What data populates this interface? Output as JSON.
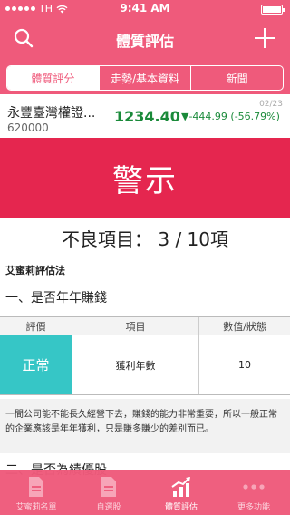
{
  "status_bar": {
    "carrier": "TH",
    "time": "9:41 AM"
  },
  "navbar": {
    "title": "體質評估"
  },
  "tabs": [
    {
      "label": "體質評分",
      "active": true
    },
    {
      "label": "走勢/基本資料",
      "active": false
    },
    {
      "label": "新聞",
      "active": false
    }
  ],
  "stock": {
    "name": "永豐臺灣權證...",
    "code": "620000",
    "price": "1234.40",
    "change": "▼-444.99 (-56.79%)",
    "date": "02/23"
  },
  "warning": {
    "label": "警示"
  },
  "summary": {
    "bad_items": "不良項目： 3 / 10項"
  },
  "method": {
    "title": "艾蜜莉評估法"
  },
  "section1": {
    "title": "一、是否年年賺錢"
  },
  "table": {
    "headers": [
      "評價",
      "項目",
      "數值/狀態"
    ],
    "rows": [
      {
        "rating": "正常",
        "item": "獲利年數",
        "value": "10"
      }
    ]
  },
  "note": {
    "text": "一間公司能不能長久經營下去，賺錢的能力非常重要，所以一般正常的企業應該是年年獲利，只是賺多賺少的差別而已。"
  },
  "section2": {
    "title": "二、是否為績優股"
  },
  "tabbar": [
    {
      "label": "艾蜜莉名單",
      "icon": "document-icon",
      "active": false
    },
    {
      "label": "自選股",
      "icon": "document-icon",
      "active": false
    },
    {
      "label": "體質評估",
      "icon": "chart-icon",
      "active": true
    },
    {
      "label": "更多功能",
      "icon": "more-icon",
      "active": false
    }
  ],
  "colors": {
    "primary": "#ef5a7b",
    "warning": "#e5264f",
    "normal": "#36c6c6",
    "down": "#1a8a3a"
  }
}
